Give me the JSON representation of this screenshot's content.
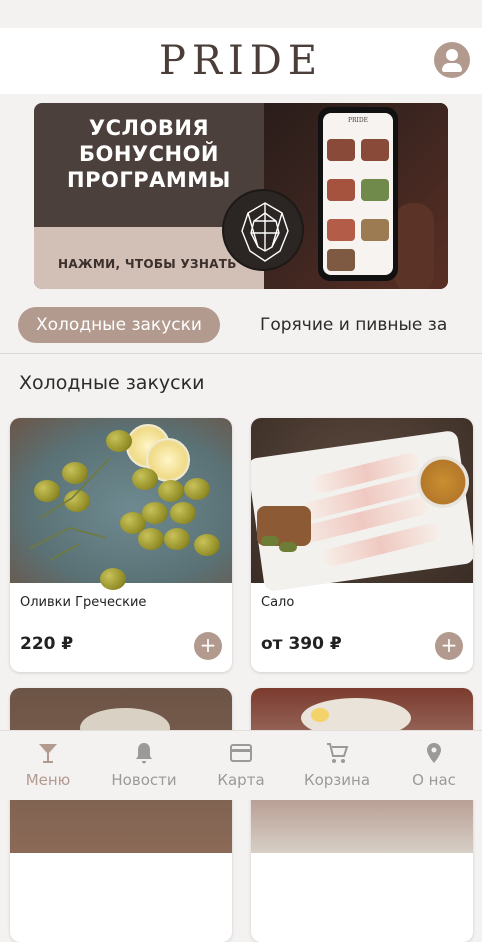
{
  "app": {
    "logo": "PRIDE"
  },
  "header": {
    "profile_icon": "user-circle-icon"
  },
  "banner": {
    "title_line1": "УСЛОВИЯ",
    "title_line2": "БОНУСНОЙ",
    "title_line3": "ПРОГРАММЫ",
    "cta": "НАЖМИ, ЧТОБЫ УЗНАТЬ",
    "phone_logo": "PRIDE"
  },
  "categories": {
    "tabs": [
      {
        "label": "Холодные закуски",
        "active": true
      },
      {
        "label": "Горячие и пивные за",
        "active": false
      }
    ]
  },
  "section": {
    "title": "Холодные закуски"
  },
  "products": [
    {
      "name": "Оливки Греческие",
      "price": "220 ₽"
    },
    {
      "name": "Сало",
      "price": "от 390 ₽"
    },
    {
      "name": "",
      "price": ""
    },
    {
      "name": "",
      "price": ""
    }
  ],
  "add_symbol": "+",
  "nav": [
    {
      "label": "Меню",
      "icon": "cocktail-icon",
      "active": true
    },
    {
      "label": "Новости",
      "icon": "bell-icon",
      "active": false
    },
    {
      "label": "Карта",
      "icon": "credit-card-icon",
      "active": false
    },
    {
      "label": "Корзина",
      "icon": "cart-icon",
      "active": false
    },
    {
      "label": "О нас",
      "icon": "map-pin-icon",
      "active": false
    }
  ],
  "colors": {
    "accent": "#b29a8e",
    "banner_dark": "#4b403b",
    "logo": "#4b3e38",
    "nav_inactive": "#9a9a9a"
  }
}
